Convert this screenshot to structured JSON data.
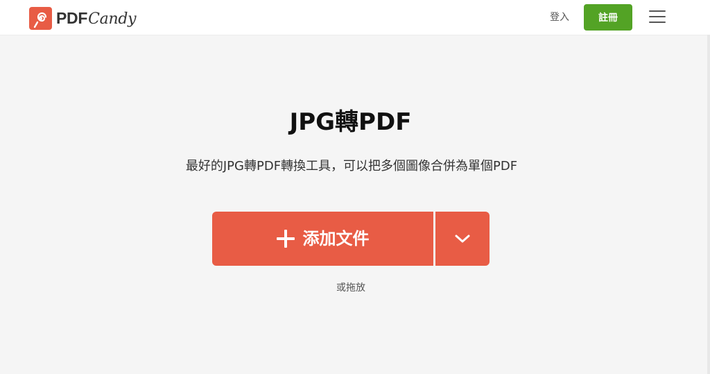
{
  "header": {
    "logo": {
      "brand_primary": "PDF",
      "brand_secondary": "Candy",
      "icon": "lollipop-icon",
      "badge_color": "#e85c45"
    },
    "login_label": "登入",
    "signup_label": "註冊",
    "signup_color": "#53a325",
    "menu_icon": "hamburger-menu-icon"
  },
  "main": {
    "title": "JPG轉PDF",
    "subtitle": "最好的JPG轉PDF轉換工具，可以把多個圖像合併為單個PDF",
    "add_files_label": "添加文件",
    "add_icon": "plus-icon",
    "dropdown_icon": "chevron-down-icon",
    "accent_color": "#e85c45",
    "drop_hint": "或拖放"
  }
}
